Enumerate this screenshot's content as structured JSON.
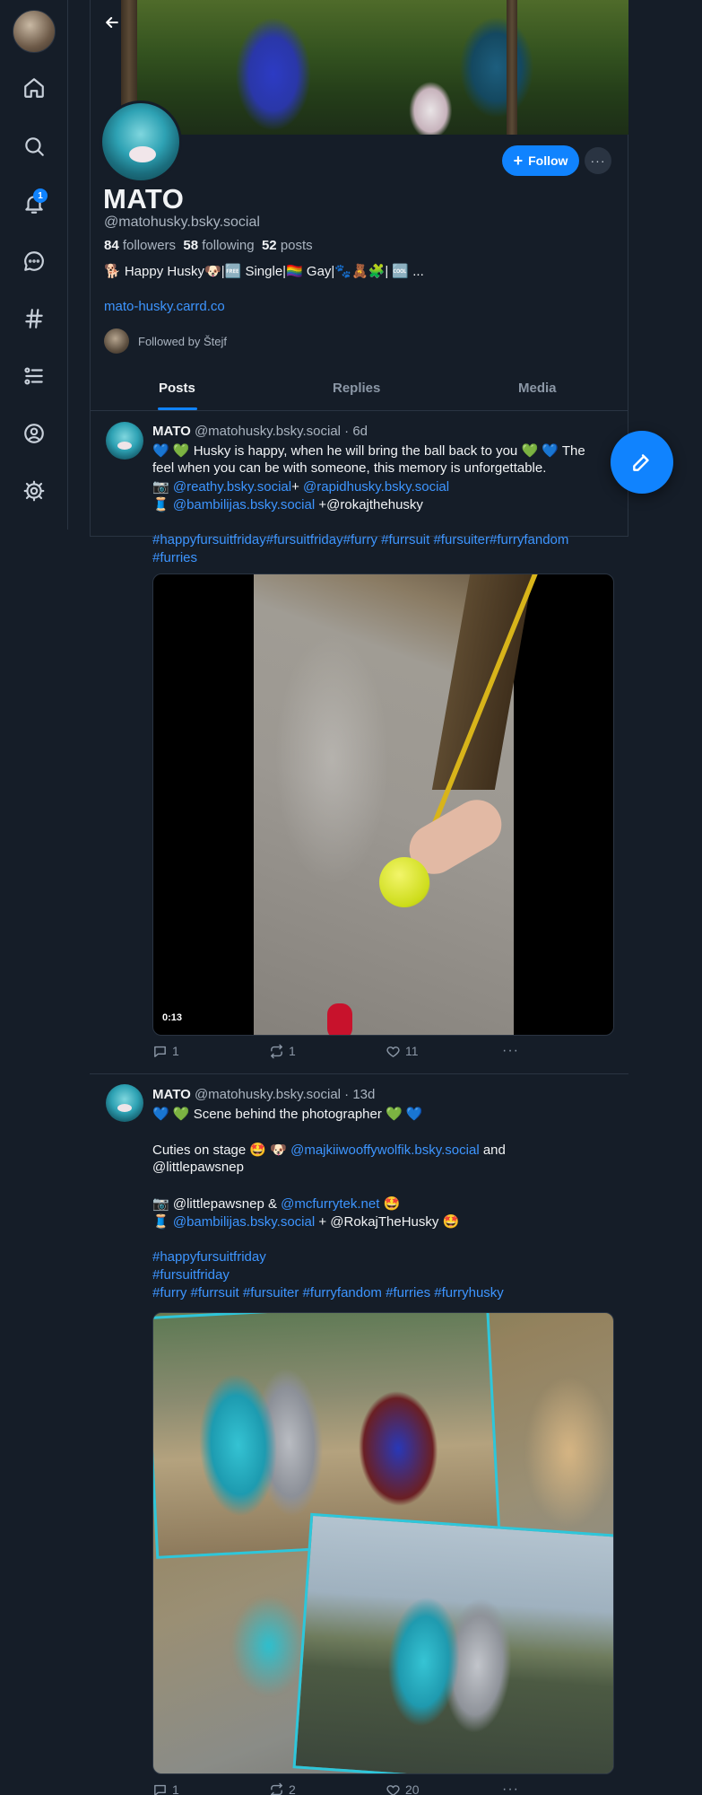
{
  "nav": {
    "notifications_count": "1"
  },
  "profile": {
    "display_name": "MATO",
    "handle": "@matohusky.bsky.social",
    "followers_count": "84",
    "followers_label": "followers",
    "following_count": "58",
    "following_label": "following",
    "posts_count": "52",
    "posts_label": "posts",
    "bio": "🐕 Happy Husky🐶|🆓 Single|🏳️‍🌈 Gay|🐾🧸🧩| 🆒 ...",
    "website": "mato-husky.carrd.co",
    "followed_by": "Followed by Štejf",
    "follow_label": "Follow",
    "more_label": "···"
  },
  "tabs": [
    "Posts",
    "Replies",
    "Media"
  ],
  "posts": [
    {
      "author": "MATO",
      "meta": "@matohusky.bsky.social · 6d",
      "line1": "💙 💚 Husky is happy, when he will bring the ball back to you 💚 💙  The",
      "line2": "feel when you can be with someone, this memory is unforgettable.",
      "line3_prefix": "📷 ",
      "line3_link1": "@reathy.bsky.social",
      "line3_mid": "+ ",
      "line3_link2": "@rapidhusky.bsky.social",
      "line4_prefix": "🧵 ",
      "line4_link": "@bambilijas.bsky.social",
      "line4_suffix": " +@rokajthehusky",
      "hashtags1": "#happyfursuitfriday#fursuitfriday#furry #furrsuit #fursuiter#furryfandom",
      "hashtags2": "#furries",
      "duration": "0:13",
      "replies": "1",
      "reposts": "1",
      "likes": "11"
    },
    {
      "author": "MATO",
      "meta": "@matohusky.bsky.social · 13d",
      "line1": "💙 💚 Scene behind the photographer 💚 💙",
      "line2_prefix": "Cuties on stage 🤩 🐶 ",
      "line2_link": "@majkiiwooffywolfik.bsky.social",
      "line2_suffix": "  and",
      "line3": "@littlepawsnep",
      "line4_prefix": "📷 @littlepawsnep & ",
      "line4_link": "@mcfurrytek.net",
      "line4_suffix": "  🤩",
      "line5_prefix": "🧵 ",
      "line5_link": "@bambilijas.bsky.social",
      "line5_suffix": "  + @RokajTheHusky 🤩",
      "hashtag1": "#happyfursuitfriday",
      "hashtag2": "#fursuitfriday",
      "hashtag3": "#furry #furrsuit #fursuiter #furryfandom #furries #furryhusky",
      "replies": "1",
      "reposts": "2",
      "likes": "20"
    }
  ],
  "colors": {
    "accent": "#1083fe",
    "background": "#151d28",
    "link": "#3d95ff"
  }
}
